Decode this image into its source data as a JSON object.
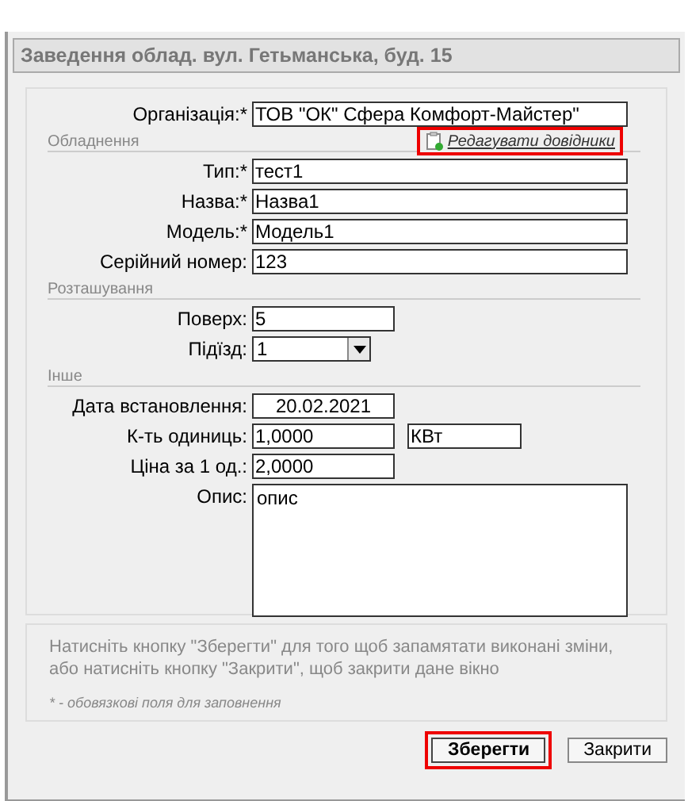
{
  "window": {
    "title": "Заведення облад. вул. Гетьманська, буд. 15"
  },
  "sections": [
    {
      "fields": [
        {
          "kind": "text",
          "label": "Організація:*",
          "value": "ТОВ \"ОК\" Сфера Комфорт-Майстер\""
        }
      ]
    },
    {
      "heading": "Обладнення",
      "link": {
        "label": "Редагувати довідники",
        "highlighted": true
      },
      "fields": [
        {
          "kind": "text",
          "label": "Тип:*",
          "value": "тест1"
        },
        {
          "kind": "text",
          "label": "Назва:*",
          "value": "Назва1"
        },
        {
          "kind": "text",
          "label": "Модель:*",
          "value": "Модель1"
        },
        {
          "kind": "text",
          "label": "Серійний номер:",
          "value": "123"
        }
      ]
    },
    {
      "heading": "Розташування",
      "fields": [
        {
          "kind": "short",
          "label": "Поверх:",
          "value": "5"
        },
        {
          "kind": "select",
          "label": "Підїзд:",
          "value": "1"
        }
      ]
    },
    {
      "heading": "Інше",
      "fields": [
        {
          "kind": "date",
          "label": "Дата встановлення:",
          "value": "20.02.2021"
        },
        {
          "kind": "pair",
          "label": "К-ть одиниць:",
          "value": "1,0000",
          "unit": "КВт"
        },
        {
          "kind": "short",
          "label": "Ціна за 1 од.:",
          "value": "2,0000"
        },
        {
          "kind": "textarea",
          "label": "Опис:",
          "value": "опис"
        }
      ]
    }
  ],
  "hint": {
    "text": "Натисніть кнопку \"Зберегти\" для того щоб запамятати виконані зміни, або натисніть кнопку \"Закрити\", щоб закрити дане вікно",
    "note": "* - обовязкові поля для заповнення"
  },
  "buttons": [
    {
      "label": "Зберегти",
      "highlighted": true,
      "primary": true
    },
    {
      "label": "Закрити",
      "highlighted": false,
      "primary": false
    }
  ]
}
